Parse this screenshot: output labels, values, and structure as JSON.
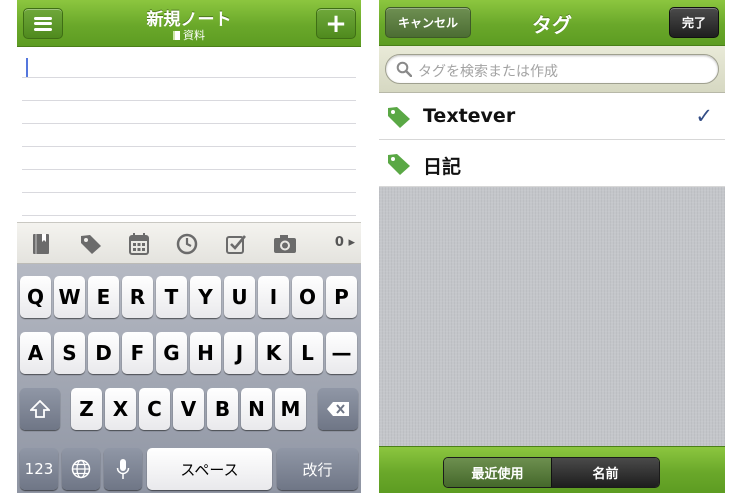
{
  "left": {
    "header": {
      "title": "新規ノート",
      "notebook": "資料"
    },
    "toolbar": {
      "count": "0"
    },
    "keyboard": {
      "row1": [
        "Q",
        "W",
        "E",
        "R",
        "T",
        "Y",
        "U",
        "I",
        "O",
        "P"
      ],
      "row2": [
        "A",
        "S",
        "D",
        "F",
        "G",
        "H",
        "J",
        "K",
        "L",
        "—"
      ],
      "row3": [
        "Z",
        "X",
        "C",
        "V",
        "B",
        "N",
        "M"
      ],
      "numbers_label": "123",
      "space_label": "スペース",
      "return_label": "改行"
    }
  },
  "right": {
    "header": {
      "cancel_label": "キャンセル",
      "title": "タグ",
      "done_label": "完了"
    },
    "search": {
      "placeholder": "タグを検索または作成"
    },
    "tags": [
      {
        "label": "Textever",
        "checked": true
      },
      {
        "label": "日記",
        "checked": false
      }
    ],
    "sort": {
      "recent_label": "最近使用",
      "name_label": "名前",
      "selected": "recent"
    }
  },
  "colors": {
    "accent_green": "#6aa82a",
    "check_blue": "#344e86",
    "tag_green": "#5aa845"
  }
}
